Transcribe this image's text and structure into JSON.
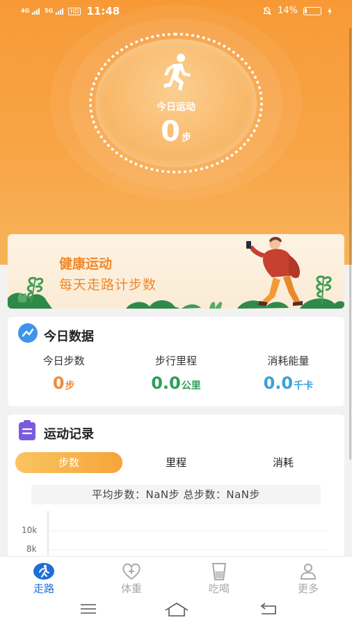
{
  "status_bar": {
    "network_1": "4G",
    "network_2": "5G",
    "hd_badge": "HD",
    "time": "11:48",
    "battery_percent_text": "14%",
    "battery_level": 0.14
  },
  "hero": {
    "label": "今日运动",
    "steps_value": "0",
    "steps_unit": "步"
  },
  "banner": {
    "line1": "健康运动",
    "line2": "每天走路计步数"
  },
  "today_card": {
    "title": "今日数据",
    "stats": [
      {
        "label": "今日步数",
        "value": "0",
        "unit": "步",
        "color": "#f28a3c"
      },
      {
        "label": "步行里程",
        "value": "0.0",
        "unit": "公里",
        "color": "#2e9e58"
      },
      {
        "label": "消耗能量",
        "value": "0.0",
        "unit": "千卡",
        "color": "#3aa0dc"
      }
    ]
  },
  "record_card": {
    "title": "运动记录",
    "tabs": [
      "步数",
      "里程",
      "消耗"
    ],
    "active_tab": 0,
    "summary": "平均步数：NaN步 总步数：NaN步",
    "chart_y_labels": [
      "10k",
      "8k"
    ]
  },
  "bottom_nav": {
    "items": [
      {
        "label": "走路",
        "icon": "walk-icon",
        "active": true
      },
      {
        "label": "体重",
        "icon": "heart-plus-icon",
        "active": false
      },
      {
        "label": "吃喝",
        "icon": "cup-icon",
        "active": false
      },
      {
        "label": "更多",
        "icon": "person-icon",
        "active": false
      }
    ],
    "active_color": "#1e6fd6",
    "inactive_color": "#a8a8a8"
  },
  "system_nav": {
    "icons": [
      "menu-icon",
      "home-icon",
      "back-icon"
    ]
  },
  "colors": {
    "brand_orange": "#f79a36",
    "steps_orange": "#f28a3c",
    "distance_green": "#2e9e58",
    "energy_blue": "#3aa0dc"
  }
}
